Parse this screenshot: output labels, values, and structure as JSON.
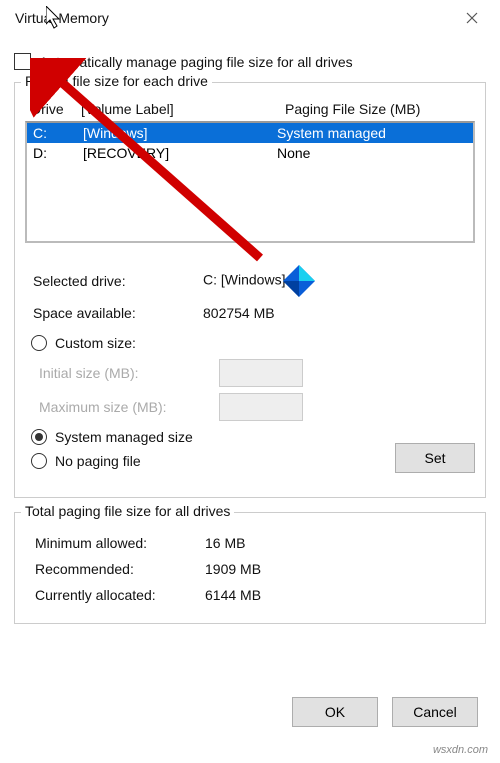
{
  "window": {
    "title": "Virtual Memory"
  },
  "auto_checkbox": {
    "label": "Automatically manage paging file size for all drives"
  },
  "drive_group": {
    "legend": "Paging file size for each drive"
  },
  "headers": {
    "drive": "Drive",
    "volume": "[Volume Label]",
    "size": "Paging File Size (MB)"
  },
  "rows": [
    {
      "drive": "C:",
      "volume": "[Windows]",
      "size": "System managed"
    },
    {
      "drive": "D:",
      "volume": "[RECOVERY]",
      "size": "None"
    }
  ],
  "selected": {
    "label": "Selected drive:",
    "value": "C:  [Windows]",
    "space_label": "Space available:",
    "space_value": "802754 MB"
  },
  "radios": {
    "custom": "Custom size:",
    "initial": "Initial size (MB):",
    "maximum": "Maximum size (MB):",
    "system": "System managed size",
    "none": "No paging file"
  },
  "set_label": "Set",
  "totals": {
    "legend": "Total paging file size for all drives",
    "min_label": "Minimum allowed:",
    "min_value": "16 MB",
    "rec_label": "Recommended:",
    "rec_value": "1909 MB",
    "cur_label": "Currently allocated:",
    "cur_value": "6144 MB"
  },
  "buttons": {
    "ok": "OK",
    "cancel": "Cancel"
  },
  "watermark": "wsxdn.com"
}
